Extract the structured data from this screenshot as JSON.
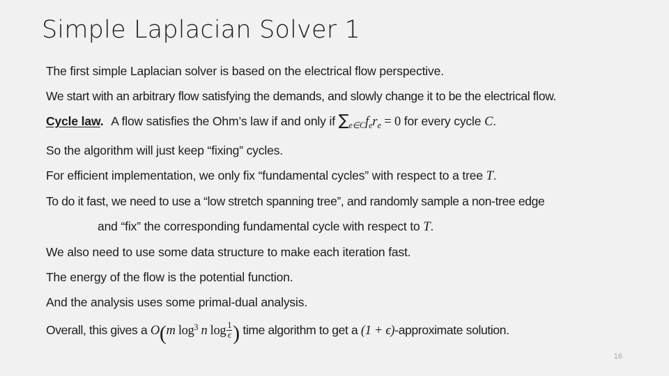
{
  "slide": {
    "title": "Simple Laplacian Solver 1",
    "page_number": "16",
    "background_color": "#f1f1f1",
    "text_color": "#1c1c1c",
    "page_number_color": "#a8a8a8",
    "lines": [
      {
        "id": "line-1",
        "text": "The first simple Laplacian solver is based on the electrical flow perspective."
      },
      {
        "id": "line-2",
        "text": "We start with an arbitrary flow satisfying the demands, and slowly change it to be the electrical flow."
      },
      {
        "id": "line-3",
        "label": "Cycle law",
        "text_before": ".",
        "text_mid": "A flow satisfies the Ohm’s law if and only if",
        "math": "∑",
        "math_sub": "e∈C",
        "math_f": "f",
        "math_f_sub": "e",
        "math_r": "r",
        "math_r_sub": "e",
        "math_eq": "= 0",
        "text_after": "for every cycle",
        "math_c": "C",
        "text_end": "."
      },
      {
        "id": "line-4",
        "text": "So the algorithm will just keep “fixing” cycles."
      },
      {
        "id": "line-5",
        "text_before": "For efficient implementation, we only fix “fundamental cycles” with respect to a tree",
        "math_t": "T",
        "text_after": "."
      },
      {
        "id": "line-6",
        "text": "To do it fast, we need to use a “low stretch spanning tree”, and randomly sample a non-tree edge"
      },
      {
        "id": "line-7",
        "indent": true,
        "text_before": "and “fix” the corresponding fundamental cycle with respect to",
        "math_t": "T",
        "text_after": "."
      },
      {
        "id": "line-8",
        "text": "We also need to use some data structure to make each iteration fast."
      },
      {
        "id": "line-9",
        "text": "The energy of the flow is the potential function."
      },
      {
        "id": "line-10",
        "text": "And the analysis uses some primal-dual analysis."
      },
      {
        "id": "line-11",
        "text_before": "Overall, this gives a",
        "math_o": "O",
        "paren_open": "(",
        "math_m": "m",
        "math_log1": "log",
        "math_log1_sup": "3",
        "math_n": "n",
        "math_log2": "log",
        "frac_num": "1",
        "frac_den": "ϵ",
        "paren_close": ")",
        "text_mid": "time algorithm to get a",
        "math_eps_expr": "(1 + ϵ)",
        "text_after": "-approximate solution."
      }
    ]
  }
}
